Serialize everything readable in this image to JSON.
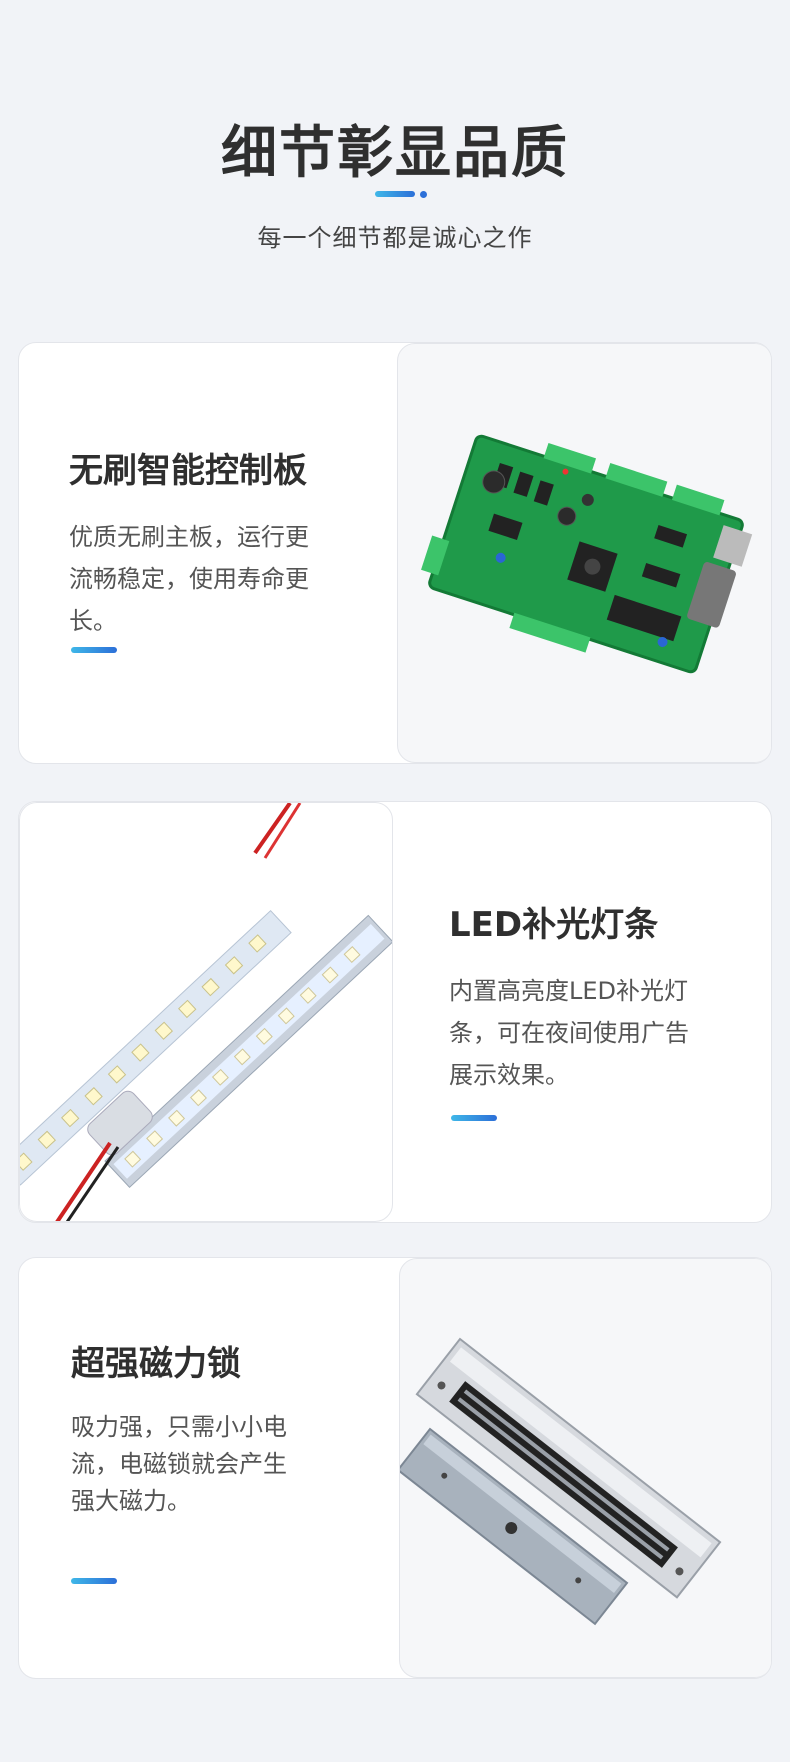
{
  "header": {
    "title": "细节彰显品质",
    "subtitle": "每一个细节都是诚心之作"
  },
  "colors": {
    "accent_start": "#3fb7e8",
    "accent_end": "#2c6fd8",
    "background": "#f1f3f7"
  },
  "cards": [
    {
      "title": "无刷智能控制板",
      "description": "优质无刷主板，运行更流畅稳定，使用寿命更长。",
      "image": "pcb-board-image"
    },
    {
      "title": "LED补光灯条",
      "description": "内置高亮度LED补光灯条，可在夜间使用广告展示效果。",
      "image": "led-strip-image"
    },
    {
      "title": "超强磁力锁",
      "description": "吸力强，只需小小电流，电磁锁就会产生强大磁力。",
      "image": "magnetic-lock-image"
    }
  ]
}
